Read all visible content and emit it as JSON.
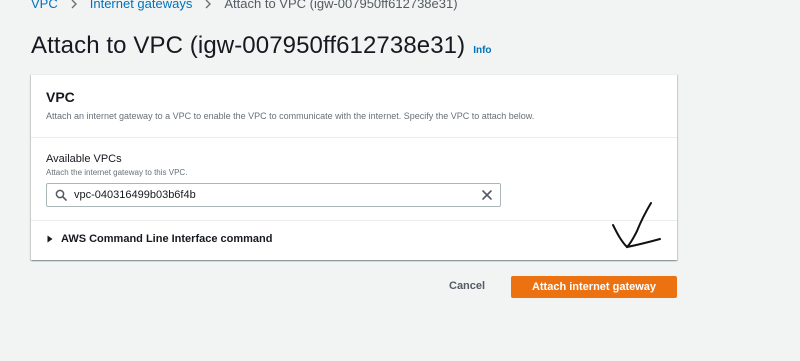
{
  "breadcrumb": {
    "items": [
      "VPC",
      "Internet gateways"
    ],
    "current": "Attach to VPC (igw-007950ff612738e31)",
    "separator_icon": "chevron-right-icon"
  },
  "page": {
    "title": "Attach to VPC (igw-007950ff612738e31)",
    "info_label": "Info"
  },
  "panel": {
    "title": "VPC",
    "description": "Attach an internet gateway to a VPC to enable the VPC to communicate with the internet. Specify the VPC to attach below."
  },
  "field": {
    "label": "Available VPCs",
    "description": "Attach the internet gateway to this VPC.",
    "value": "vpc-040316499b03b6f4b",
    "leading_icon": "search-icon",
    "trailing_icon": "close-icon"
  },
  "cli_section": {
    "label": "AWS Command Line Interface command",
    "icon": "caret-right-icon"
  },
  "actions": {
    "cancel_label": "Cancel",
    "submit_label": "Attach internet gateway"
  },
  "colors": {
    "link": "#0073bb",
    "primary": "#ec7211",
    "background": "#f2f3f3"
  }
}
